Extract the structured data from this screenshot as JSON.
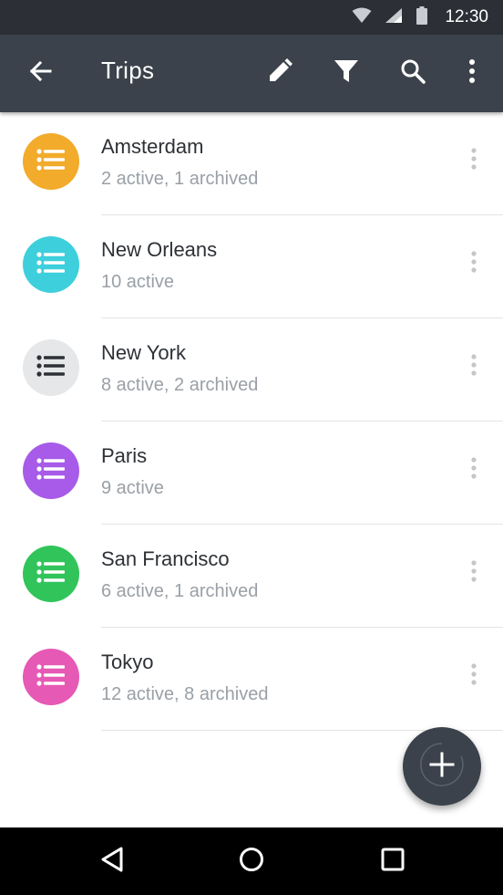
{
  "status_bar": {
    "time": "12:30",
    "icons": [
      "wifi-icon",
      "signal-icon",
      "battery-icon"
    ]
  },
  "app_bar": {
    "title": "Trips",
    "actions": [
      "edit-icon",
      "filter-icon",
      "search-icon",
      "more-vert-icon"
    ]
  },
  "trips": [
    {
      "name": "Amsterdam",
      "subtitle": "2 active, 1 archived",
      "color": "#f2ab2a"
    },
    {
      "name": "New Orleans",
      "subtitle": "10 active",
      "color": "#3dcfdc"
    },
    {
      "name": "New York",
      "subtitle": "8 active, 2 archived",
      "color": "#e6e7e9"
    },
    {
      "name": "Paris",
      "subtitle": "9 active",
      "color": "#a75be8"
    },
    {
      "name": "San Francisco",
      "subtitle": "6 active, 1 archived",
      "color": "#31c45b"
    },
    {
      "name": "Tokyo",
      "subtitle": "12 active, 8 archived",
      "color": "#e659b4"
    }
  ],
  "colors": {
    "status_bar": "#2c3036",
    "app_bar": "#3b424b",
    "fab": "#3b424b",
    "nav_bar": "#000000"
  },
  "fab_icon": "add-icon",
  "nav_buttons": [
    "back-nav-icon",
    "home-nav-icon",
    "recents-nav-icon"
  ]
}
